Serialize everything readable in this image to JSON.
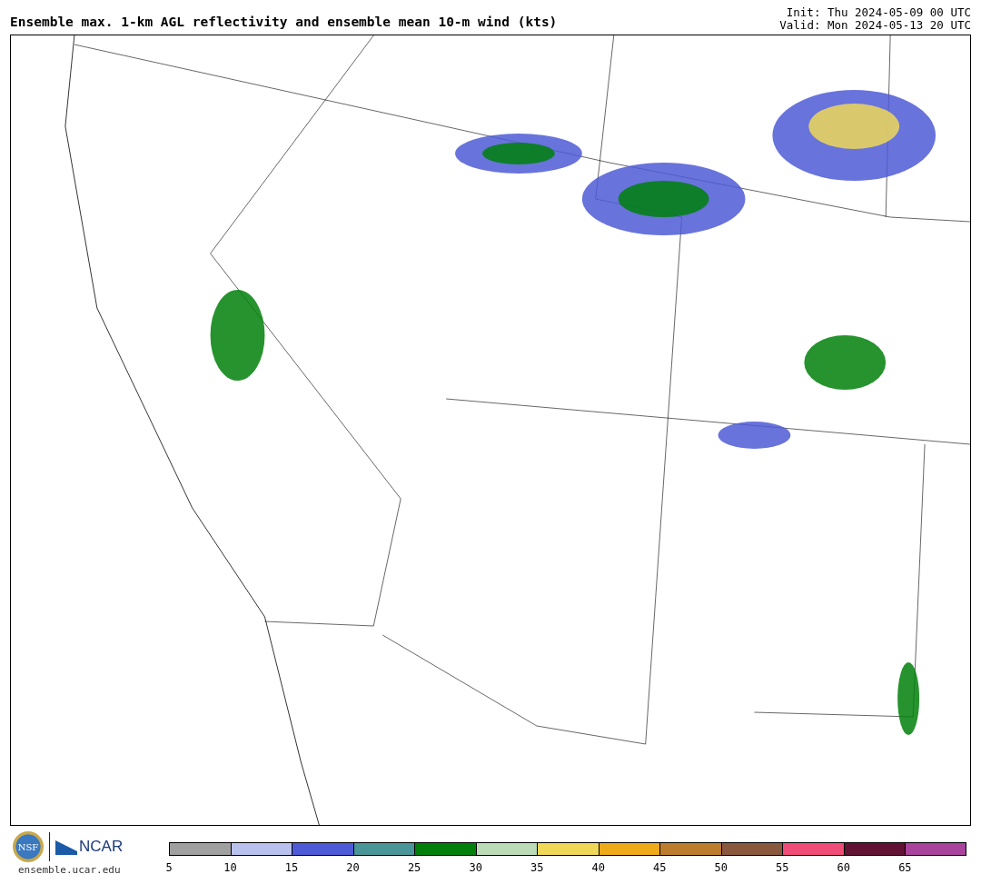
{
  "title": "Ensemble max. 1-km AGL reflectivity and ensemble mean 10-m wind (kts)",
  "init": "Init: Thu 2024-05-09 00 UTC",
  "valid": "Valid: Mon 2024-05-13 20 UTC",
  "logos": {
    "nsf": "NSF",
    "ncar": "NCAR"
  },
  "site": "ensemble.ucar.edu",
  "colorbar": [
    {
      "label": "5",
      "color": "#a0a0a0"
    },
    {
      "label": "10",
      "color": "#b8c2ec"
    },
    {
      "label": "15",
      "color": "#4e5bd6"
    },
    {
      "label": "20",
      "color": "#4a9598"
    },
    {
      "label": "25",
      "color": "#00800a"
    },
    {
      "label": "30",
      "color": "#bcdcb8"
    },
    {
      "label": "35",
      "color": "#efd858"
    },
    {
      "label": "40",
      "color": "#eeaa18"
    },
    {
      "label": "45",
      "color": "#bc7e2c"
    },
    {
      "label": "50",
      "color": "#8a583c"
    },
    {
      "label": "55",
      "color": "#f04c78"
    },
    {
      "label": "60",
      "color": "#621232"
    },
    {
      "label": "65",
      "color": "#a8449c"
    }
  ]
}
